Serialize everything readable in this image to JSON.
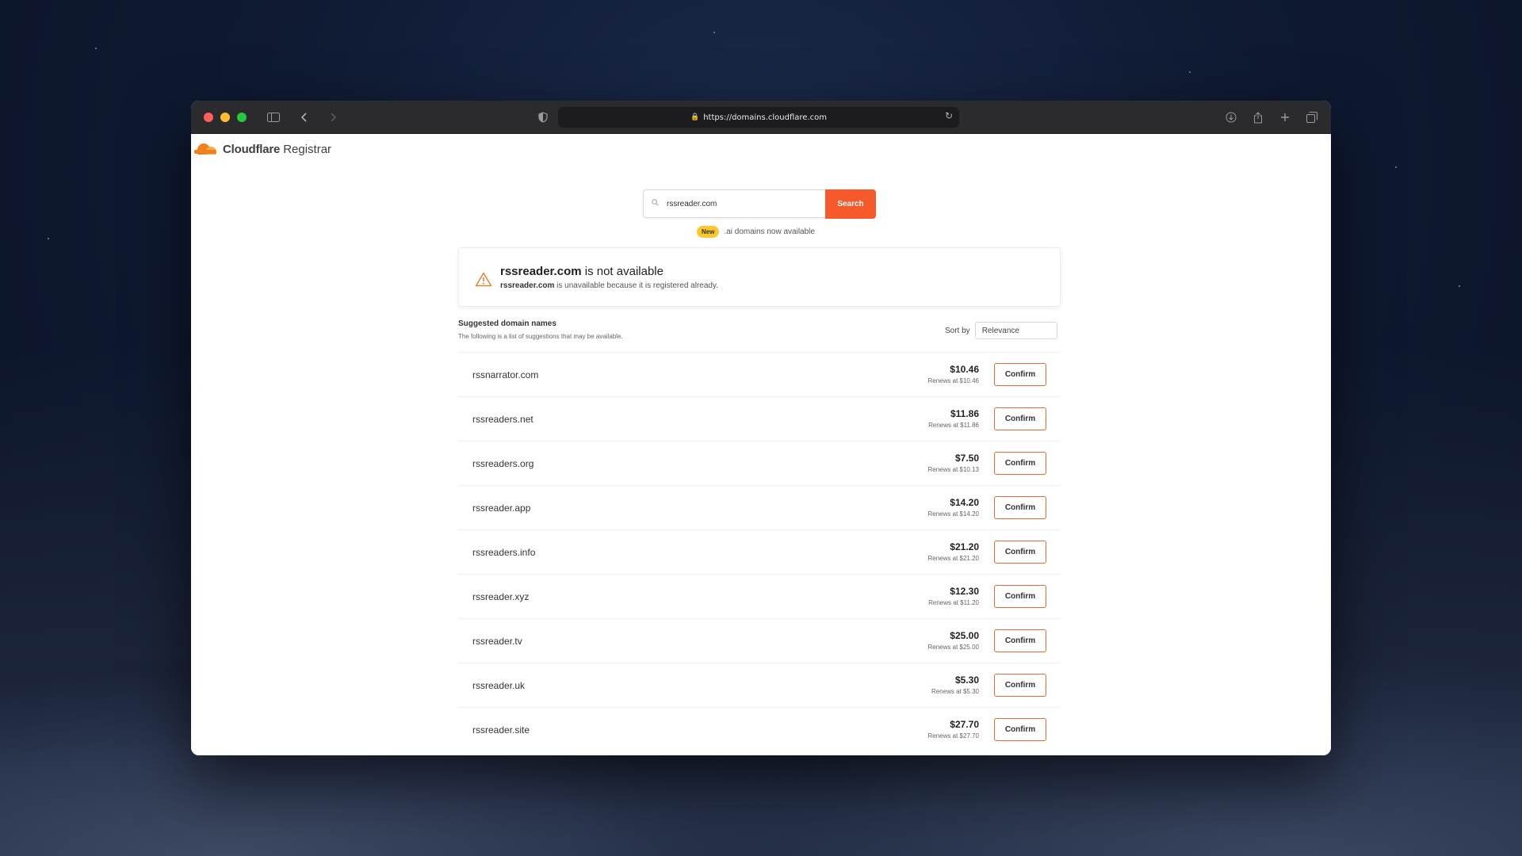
{
  "browser": {
    "url": "https://domains.cloudflare.com"
  },
  "brand": {
    "name": "Cloudflare",
    "product": "Registrar"
  },
  "search": {
    "value": "rssreader.com",
    "button_label": "Search"
  },
  "promo": {
    "badge": "New",
    "text": ".ai domains now available"
  },
  "alert": {
    "domain": "rssreader.com",
    "title_suffix": "is not available",
    "desc_domain": "rssreader.com",
    "desc_suffix": "is unavailable because it is registered already."
  },
  "suggestions": {
    "title": "Suggested domain names",
    "subtitle": "The following is a list of suggestions that may be available.",
    "sort_label": "Sort by",
    "sort_value": "Relevance",
    "confirm_label": "Confirm",
    "items": [
      {
        "domain": "rssnarrator.com",
        "price": "$10.46",
        "renews": "Renews at $10.46"
      },
      {
        "domain": "rssreaders.net",
        "price": "$11.86",
        "renews": "Renews at $11.86"
      },
      {
        "domain": "rssreaders.org",
        "price": "$7.50",
        "renews": "Renews at $10.13"
      },
      {
        "domain": "rssreader.app",
        "price": "$14.20",
        "renews": "Renews at $14.20"
      },
      {
        "domain": "rssreaders.info",
        "price": "$21.20",
        "renews": "Renews at $21.20"
      },
      {
        "domain": "rssreader.xyz",
        "price": "$12.30",
        "renews": "Renews at $11.20"
      },
      {
        "domain": "rssreader.tv",
        "price": "$25.00",
        "renews": "Renews at $25.00"
      },
      {
        "domain": "rssreader.uk",
        "price": "$5.30",
        "renews": "Renews at $5.30"
      },
      {
        "domain": "rssreader.site",
        "price": "$27.70",
        "renews": "Renews at $27.70"
      }
    ]
  }
}
